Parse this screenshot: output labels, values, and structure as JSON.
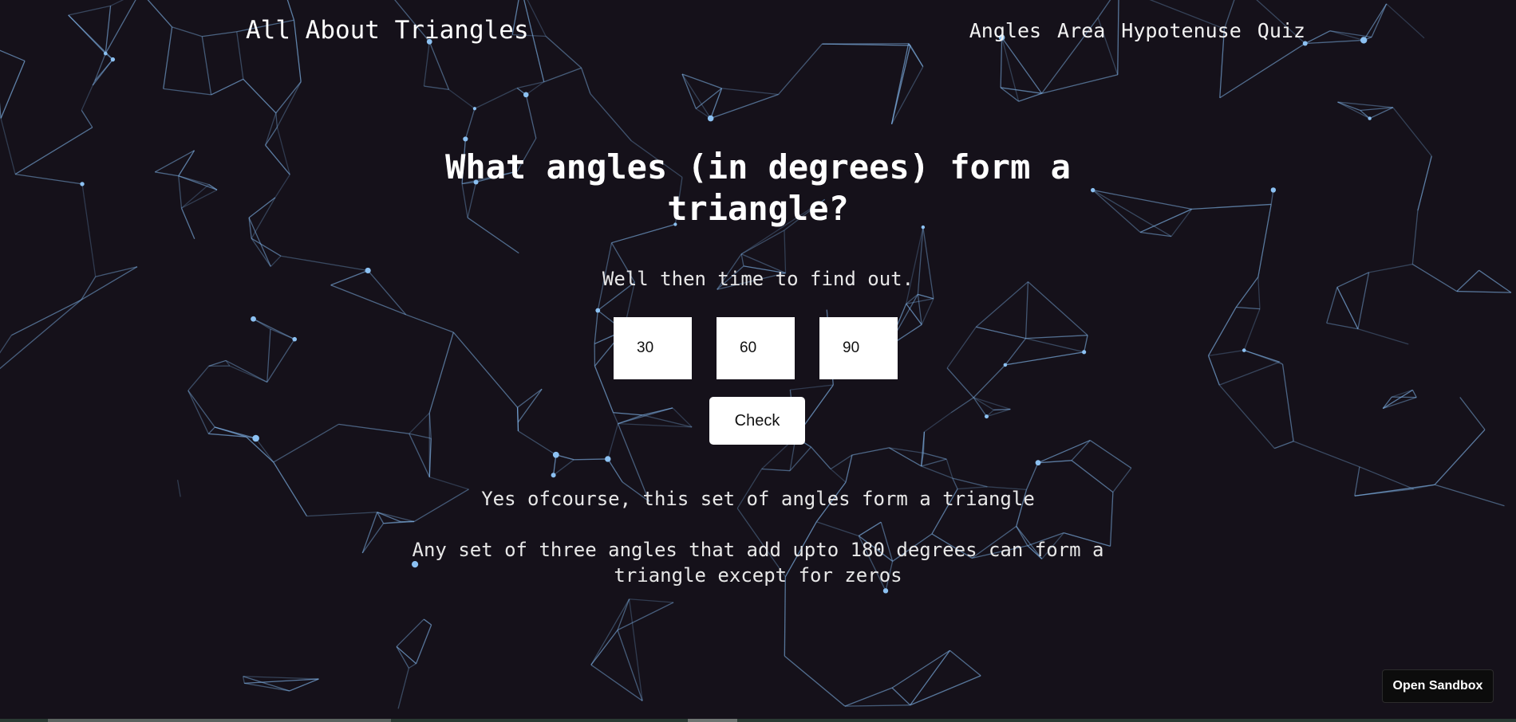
{
  "header": {
    "title": "All About Triangles",
    "nav": [
      "Angles",
      "Area",
      "Hypotenuse",
      "Quiz"
    ]
  },
  "main": {
    "question": "What angles (in degrees) form a triangle?",
    "subtitle": "Well then time to find out.",
    "inputs": [
      "30",
      "60",
      "90"
    ],
    "check_label": "Check",
    "result": "Yes ofcourse, this set of angles form a triangle",
    "explanation": "Any set of three angles that add upto 180 degrees can form a triangle except for zeros"
  },
  "sandbox_label": "Open Sandbox",
  "colors": {
    "background": "#15111a",
    "network": "#7fb2e6",
    "text": "#f2f2f2"
  }
}
